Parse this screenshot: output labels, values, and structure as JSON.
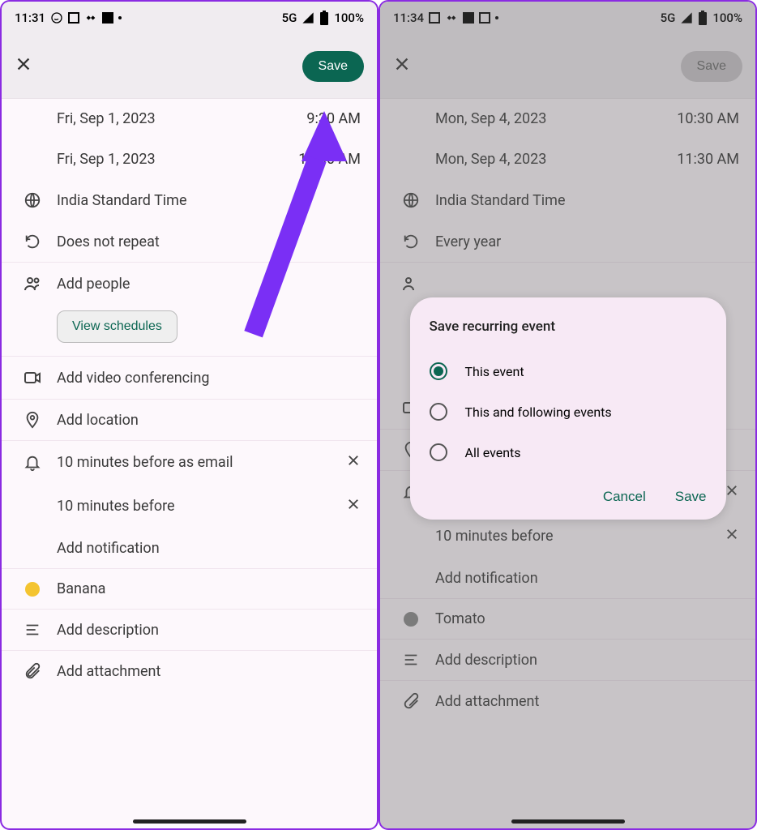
{
  "left": {
    "status": {
      "time": "11:31",
      "network": "5G",
      "battery": "100%"
    },
    "appbar": {
      "save": "Save"
    },
    "start": {
      "date": "Fri, Sep 1, 2023",
      "time": "9:30 AM"
    },
    "end": {
      "date": "Fri, Sep 1, 2023",
      "time": "10:30 AM"
    },
    "tz": "India Standard Time",
    "recur": "Does not repeat",
    "people": "Add people",
    "view_schedules": "View schedules",
    "video": "Add video conferencing",
    "location": "Add location",
    "notif1": "10 minutes before as email",
    "notif2": "10 minutes before",
    "add_notif": "Add notification",
    "calendar": {
      "name": "Banana",
      "color": "#f4c430"
    },
    "desc": "Add description",
    "attach": "Add attachment"
  },
  "right": {
    "status": {
      "time": "11:34",
      "network": "5G",
      "battery": "100%"
    },
    "appbar": {
      "save": "Save"
    },
    "start": {
      "date": "Mon, Sep 4, 2023",
      "time": "10:30 AM"
    },
    "end": {
      "date": "Mon, Sep 4, 2023",
      "time": "11:30 AM"
    },
    "tz": "India Standard Time",
    "recur": "Every year",
    "notif2": "10 minutes before",
    "add_notif": "Add notification",
    "calendar": {
      "name": "Tomato",
      "color": "#888"
    },
    "desc": "Add description",
    "attach": "Add attachment",
    "dialog": {
      "title": "Save recurring event",
      "opt1": "This event",
      "opt2": "This and following events",
      "opt3": "All events",
      "cancel": "Cancel",
      "save": "Save"
    }
  }
}
